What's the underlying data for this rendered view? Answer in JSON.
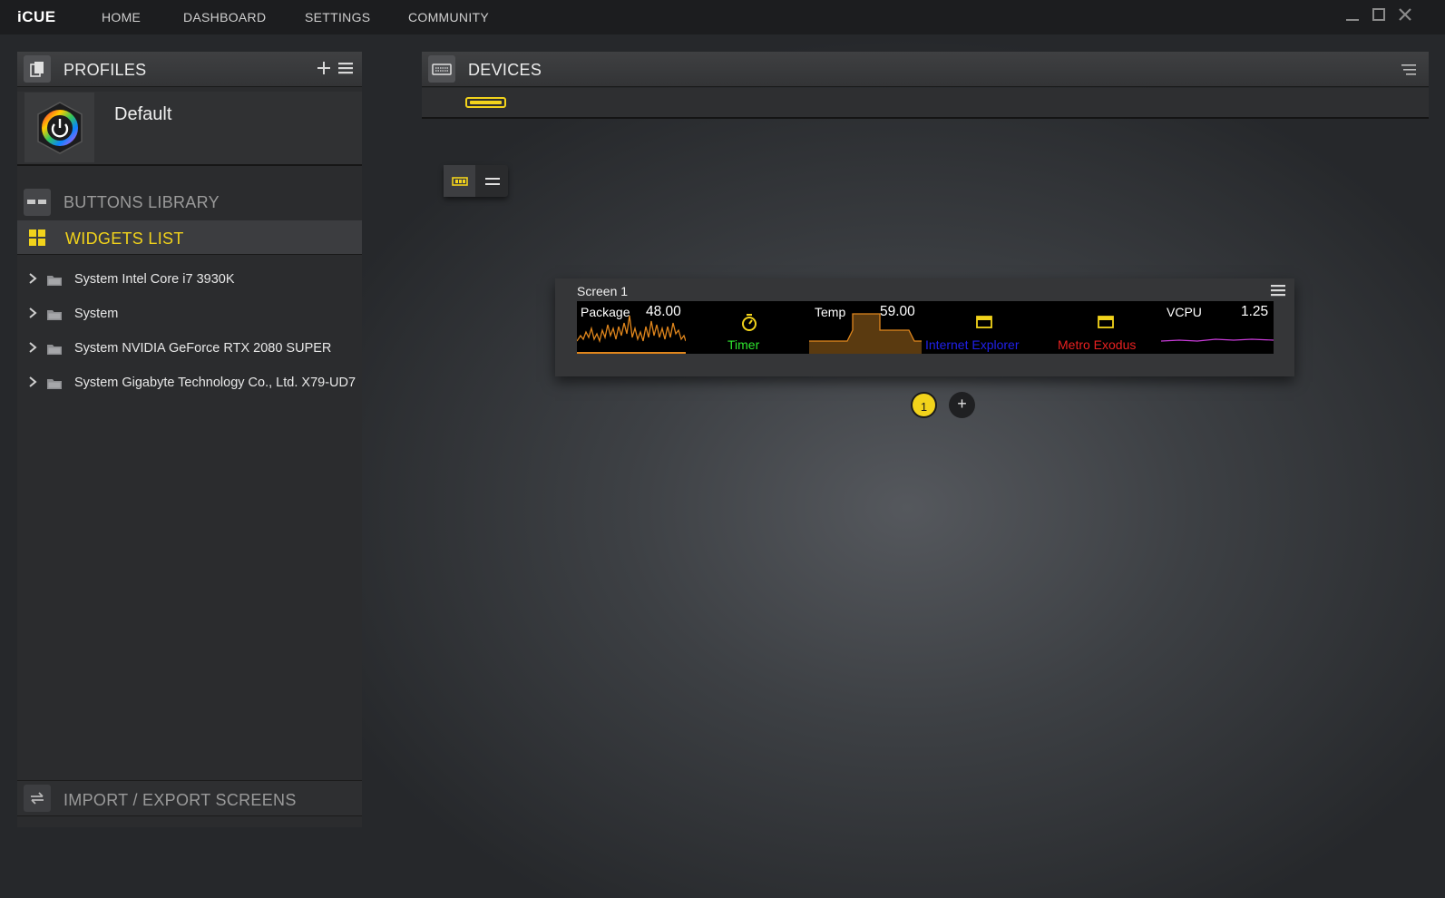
{
  "app": {
    "title": "iCUE"
  },
  "nav": {
    "home": "HOME",
    "dashboard": "DASHBOARD",
    "settings": "SETTINGS",
    "community": "COMMUNITY"
  },
  "window_controls": [
    "minimize-icon",
    "maximize-icon",
    "close-icon"
  ],
  "profiles": {
    "title": "PROFILES",
    "items": [
      {
        "name": "Default"
      }
    ]
  },
  "library": {
    "buttons_label": "BUTTONS LIBRARY",
    "widgets_label": "WIDGETS LIST"
  },
  "widgets_tree": [
    {
      "label": "System Intel Core i7 3930K"
    },
    {
      "label": "System"
    },
    {
      "label": "System NVIDIA GeForce RTX 2080 SUPER"
    },
    {
      "label": "System Gigabyte Technology Co., Ltd. X79-UD7"
    }
  ],
  "import_export": {
    "label": "IMPORT / EXPORT SCREENS"
  },
  "devices": {
    "title": "DEVICES"
  },
  "screen": {
    "title": "Screen 1",
    "widgets": {
      "package": {
        "label": "Package",
        "value": "48.00"
      },
      "timer": {
        "caption": "Timer"
      },
      "temp": {
        "label": "Temp",
        "value": "59.00"
      },
      "ie": {
        "caption": "Internet Explorer"
      },
      "metro": {
        "caption": "Metro Exodus"
      },
      "vcpu": {
        "label": "VCPU",
        "value": "1.25"
      }
    }
  },
  "pages": {
    "current": "1",
    "add": "+"
  },
  "colors": {
    "accent": "#f2d31b",
    "graph_orange": "#e0861c",
    "timer_green": "#2ee62e",
    "ie_blue": "#2020e8",
    "metro_red": "#e82020",
    "vcpu_purple": "#c83cd8"
  }
}
